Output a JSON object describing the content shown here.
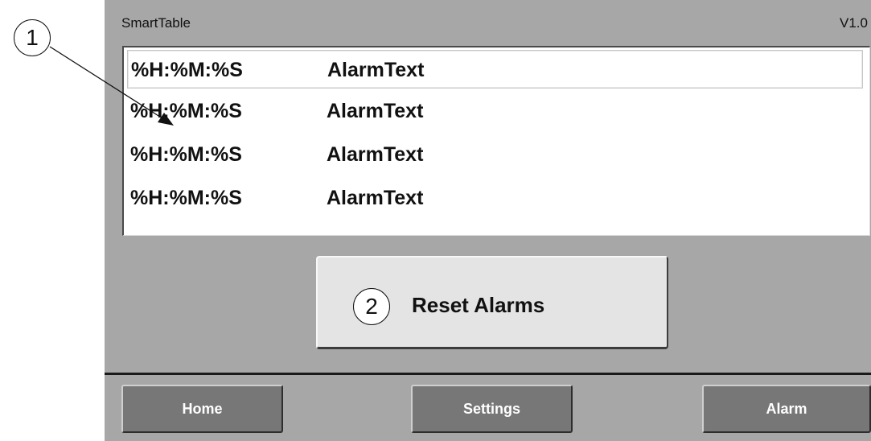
{
  "header": {
    "title": "SmartTable",
    "version": "V1.0"
  },
  "alarm_list": {
    "rows": [
      {
        "time": "%H:%M:%S",
        "text": "AlarmText"
      },
      {
        "time": "%H:%M:%S",
        "text": "AlarmText"
      },
      {
        "time": "%H:%M:%S",
        "text": "AlarmText"
      },
      {
        "time": "%H:%M:%S",
        "text": "AlarmText"
      }
    ]
  },
  "reset_button": {
    "label": "Reset Alarms",
    "callout": "2"
  },
  "callouts": {
    "one": "1"
  },
  "nav": {
    "home": "Home",
    "settings": "Settings",
    "alarm": "Alarm"
  }
}
